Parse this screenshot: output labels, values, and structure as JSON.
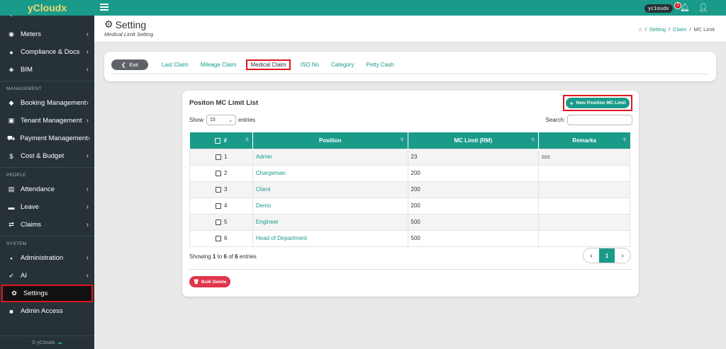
{
  "sidebar": {
    "brand": "yCloudx",
    "items_top": [
      {
        "label": "Meters",
        "icon": "gauge-icon"
      },
      {
        "label": "Compliance & Docs",
        "icon": "dot-icon"
      },
      {
        "label": "BIM",
        "icon": "cube-icon"
      }
    ],
    "section_management": "MANAGEMENT",
    "items_management": [
      {
        "label": "Booking Management",
        "icon": "tag-icon"
      },
      {
        "label": "Tenant Management",
        "icon": "building-icon"
      },
      {
        "label": "Payment Management",
        "icon": "cart-icon"
      },
      {
        "label": "Cost & Budget",
        "icon": "dollar-icon"
      }
    ],
    "section_people": "PEOPLE",
    "items_people": [
      {
        "label": "Attendance",
        "icon": "file-icon"
      },
      {
        "label": "Leave",
        "icon": "briefcase-icon"
      },
      {
        "label": "Claims",
        "icon": "exchange-icon"
      }
    ],
    "section_system": "SYSTEM",
    "items_system": [
      {
        "label": "Administration",
        "icon": "id-card-icon"
      },
      {
        "label": "AI",
        "icon": "rocket-icon"
      },
      {
        "label": "Settings",
        "icon": "gear-icon"
      },
      {
        "label": "Admin Access",
        "icon": "lock-icon"
      }
    ],
    "footer": "© yCloudx"
  },
  "topbar": {
    "user": "yc1oudx",
    "notifications": "3"
  },
  "header": {
    "title": "Setting",
    "subtitle": "Medical Limit Setting",
    "breadcrumb": [
      "Setting",
      "Claim",
      "MC Limit"
    ]
  },
  "tabs": {
    "exit": "Exit",
    "items": [
      "Last Claim",
      "Mileage Claim",
      "Medical Claim",
      "ISO No",
      "Category",
      "Petty Cash"
    ],
    "selected": "Medical Claim"
  },
  "card": {
    "title": "Positon MC Limit List",
    "new_button": "New Position MC Limit",
    "show": "Show",
    "page_size": "15",
    "entries": "entries",
    "search_label": "Search:",
    "columns": [
      "#",
      "Position",
      "MC Limit (RM)",
      "Remarks"
    ],
    "rows": [
      {
        "n": "1",
        "position": "Admin",
        "limit": "23",
        "remarks": "ccc"
      },
      {
        "n": "2",
        "position": "Chargeman",
        "limit": "200",
        "remarks": ""
      },
      {
        "n": "3",
        "position": "Client",
        "limit": "200",
        "remarks": ""
      },
      {
        "n": "4",
        "position": "Demo",
        "limit": "200",
        "remarks": ""
      },
      {
        "n": "5",
        "position": "Engineer",
        "limit": "500",
        "remarks": ""
      },
      {
        "n": "6",
        "position": "Head of Department",
        "limit": "500",
        "remarks": ""
      }
    ],
    "info_prefix": "Showing",
    "info_from": "1",
    "info_to": "to",
    "info_end": "6",
    "info_of": "of",
    "info_total": "6",
    "info_suffix": "entries",
    "current_page": "1",
    "bulk_delete": "Bulk Delete"
  },
  "colors": {
    "accent": "#1a9b8a",
    "sidebar": "#263238",
    "highlight": "#e0141e",
    "danger": "#e0344a"
  }
}
